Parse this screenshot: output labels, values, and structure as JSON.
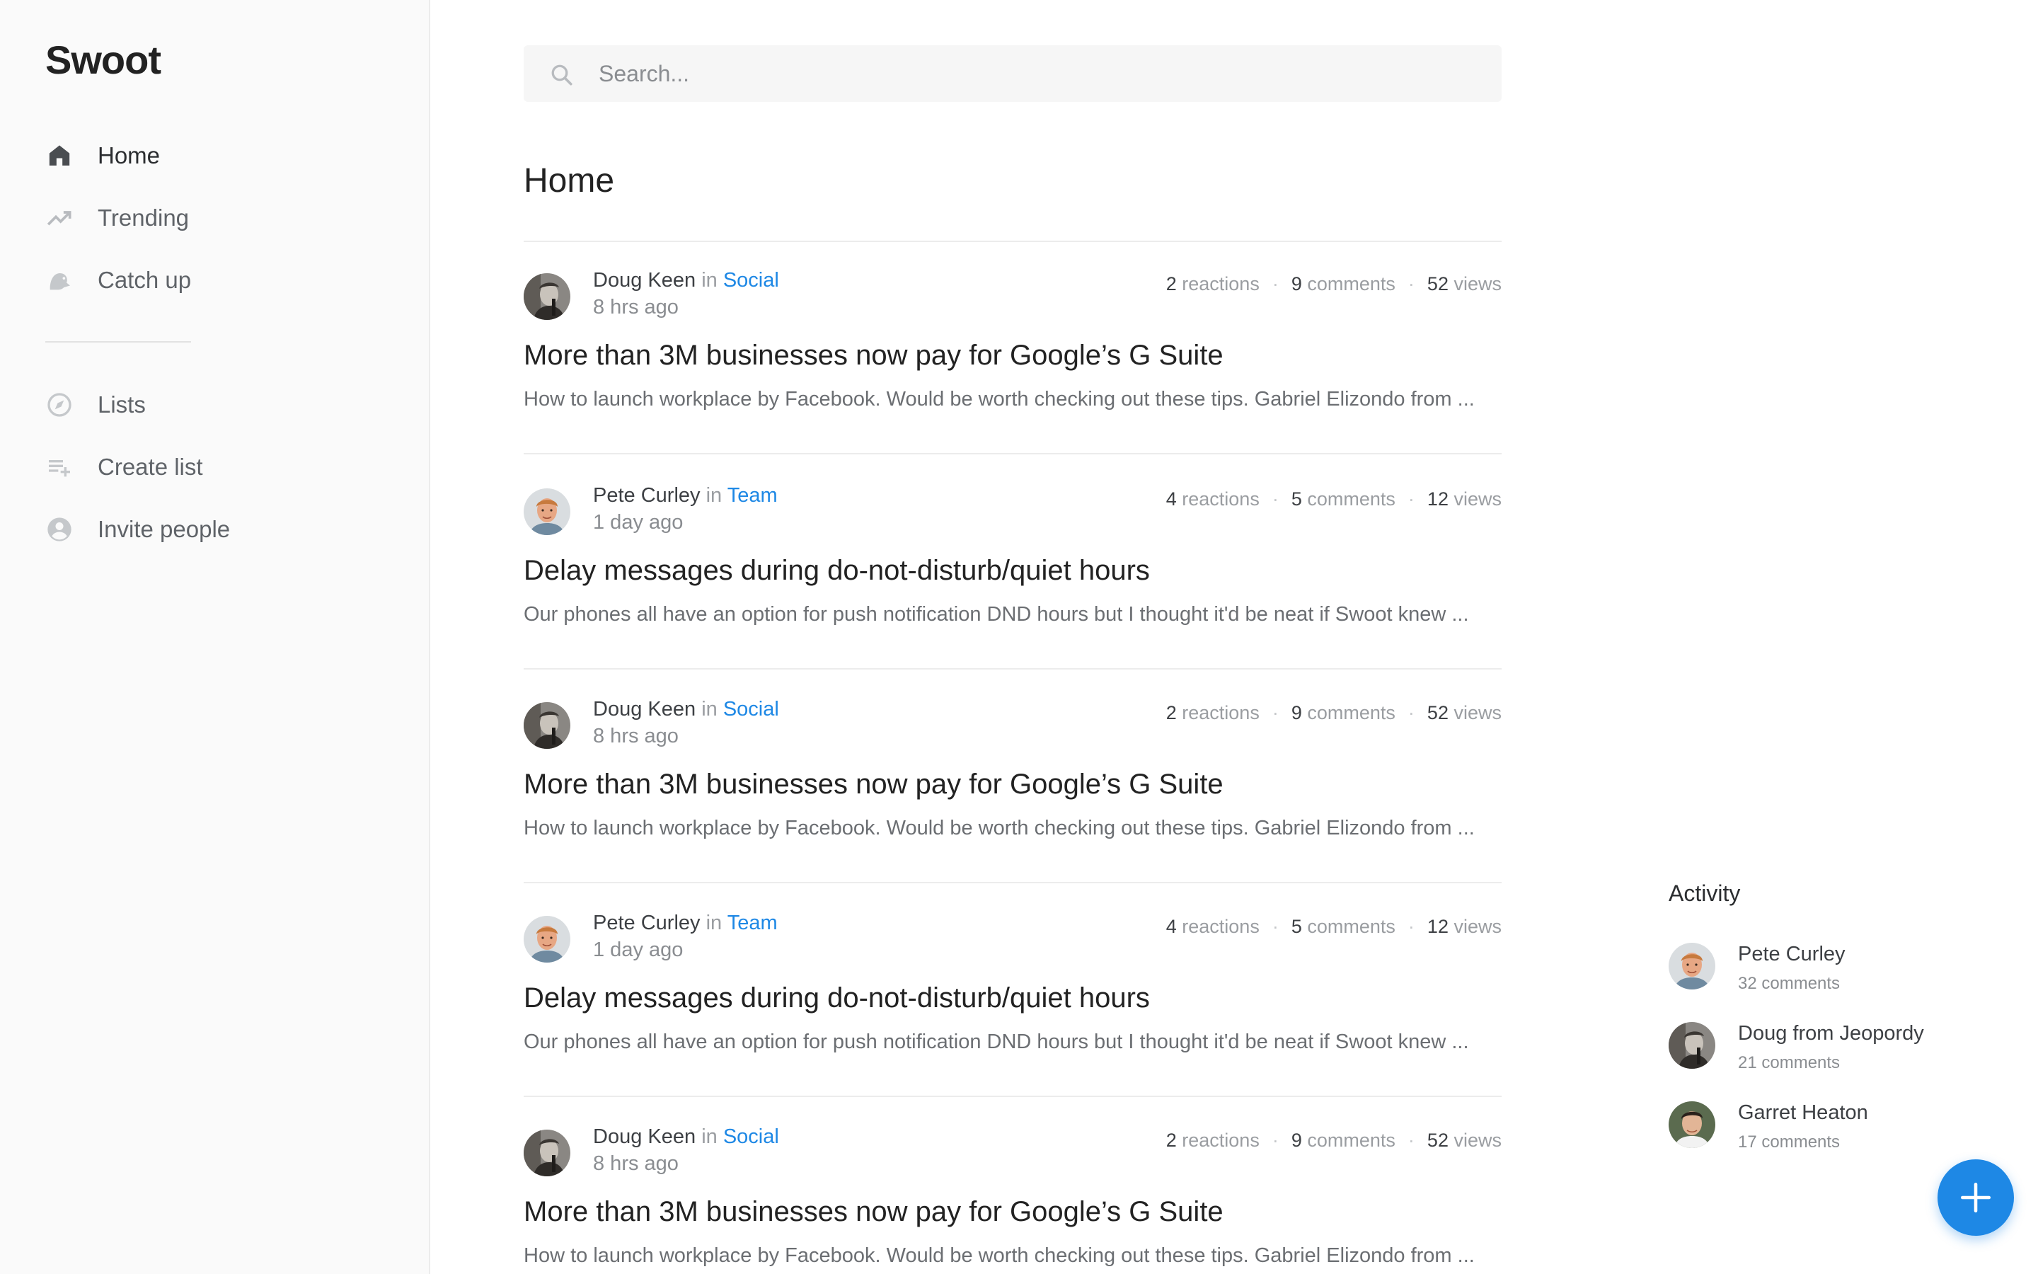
{
  "app": {
    "logo": "Swoot"
  },
  "sidebar": {
    "primary": [
      {
        "label": "Home",
        "icon": "home-icon",
        "active": true
      },
      {
        "label": "Trending",
        "icon": "trending-icon",
        "active": false
      },
      {
        "label": "Catch up",
        "icon": "catch-up-icon",
        "active": false
      }
    ],
    "secondary": [
      {
        "label": "Lists",
        "icon": "compass-icon"
      },
      {
        "label": "Create list",
        "icon": "playlist-add-icon"
      },
      {
        "label": "Invite people",
        "icon": "account-circle-icon"
      }
    ]
  },
  "search": {
    "placeholder": "Search...",
    "value": ""
  },
  "main": {
    "title": "Home"
  },
  "posts": [
    {
      "author": "Doug Keen",
      "in": "in",
      "channel": "Social",
      "time": "8 hrs ago",
      "reactions": "2",
      "reactions_label": "reactions",
      "comments": "9",
      "comments_label": "comments",
      "views": "52",
      "views_label": "views",
      "title": "More than 3M businesses now pay for Google’s G Suite",
      "excerpt": "How to launch workplace by Facebook. Would be worth checking out these tips. Gabriel Elizondo from ..."
    },
    {
      "author": "Pete Curley",
      "in": "in",
      "channel": "Team",
      "time": "1 day ago",
      "reactions": "4",
      "reactions_label": "reactions",
      "comments": "5",
      "comments_label": "comments",
      "views": "12",
      "views_label": "views",
      "title": "Delay messages during do-not-disturb/quiet hours",
      "excerpt": "Our phones all have an option for push notification DND hours but I thought it'd be neat if Swoot knew ..."
    },
    {
      "author": "Doug Keen",
      "in": "in",
      "channel": "Social",
      "time": "8 hrs ago",
      "reactions": "2",
      "reactions_label": "reactions",
      "comments": "9",
      "comments_label": "comments",
      "views": "52",
      "views_label": "views",
      "title": "More than 3M businesses now pay for Google’s G Suite",
      "excerpt": "How to launch workplace by Facebook. Would be worth checking out these tips. Gabriel Elizondo from ..."
    },
    {
      "author": "Pete Curley",
      "in": "in",
      "channel": "Team",
      "time": "1 day ago",
      "reactions": "4",
      "reactions_label": "reactions",
      "comments": "5",
      "comments_label": "comments",
      "views": "12",
      "views_label": "views",
      "title": "Delay messages during do-not-disturb/quiet hours",
      "excerpt": "Our phones all have an option for push notification DND hours but I thought it'd be neat if Swoot knew ..."
    },
    {
      "author": "Doug Keen",
      "in": "in",
      "channel": "Social",
      "time": "8 hrs ago",
      "reactions": "2",
      "reactions_label": "reactions",
      "comments": "9",
      "comments_label": "comments",
      "views": "52",
      "views_label": "views",
      "title": "More than 3M businesses now pay for Google’s G Suite",
      "excerpt": "How to launch workplace by Facebook. Would be worth checking out these tips. Gabriel Elizondo from ..."
    }
  ],
  "activity": {
    "title": "Activity",
    "items": [
      {
        "name": "Pete Curley",
        "count": "32 comments"
      },
      {
        "name": "Doug from Jeopordy",
        "count": "21 comments"
      },
      {
        "name": "Garret Heaton",
        "count": "17 comments"
      }
    ]
  },
  "fab": {
    "icon": "plus-icon"
  },
  "colors": {
    "accent": "#1e88e5",
    "sidebar_bg": "#fafafa",
    "text": "#2b2d30",
    "muted": "#8a8d91"
  }
}
